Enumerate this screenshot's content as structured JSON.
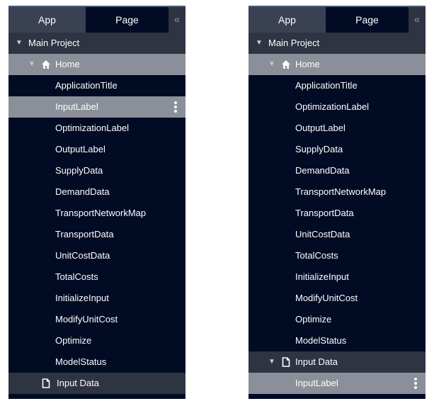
{
  "tabs": {
    "app": "App",
    "page": "Page",
    "collapse": "«"
  },
  "left_panel": {
    "project": "Main Project",
    "page": "Home",
    "items": [
      "ApplicationTitle",
      "InputLabel",
      "OptimizationLabel",
      "OutputLabel",
      "SupplyData",
      "DemandData",
      "TransportNetworkMap",
      "TransportData",
      "UnitCostData",
      "TotalCosts",
      "InitializeInput",
      "ModifyUnitCost",
      "Optimize",
      "ModelStatus"
    ],
    "selected_item": "InputLabel",
    "second_page": "Input Data"
  },
  "right_panel": {
    "project": "Main Project",
    "page": "Home",
    "items": [
      "ApplicationTitle",
      "OptimizationLabel",
      "OutputLabel",
      "SupplyData",
      "DemandData",
      "TransportNetworkMap",
      "TransportData",
      "UnitCostData",
      "TotalCosts",
      "InitializeInput",
      "ModifyUnitCost",
      "Optimize",
      "ModelStatus"
    ],
    "second_page": "Input Data",
    "second_page_items": [
      "InputLabel"
    ],
    "selected_item": "InputLabel"
  },
  "icons": {
    "expand": "triangle-down-icon",
    "home": "home-icon",
    "page": "page-icon",
    "menu": "kebab-menu-icon"
  },
  "colors": {
    "panel_bg": "#020b24",
    "header_bg": "#2e3442",
    "selected_bg": "#8a8f99",
    "tab_active_bg": "#3a4152"
  }
}
